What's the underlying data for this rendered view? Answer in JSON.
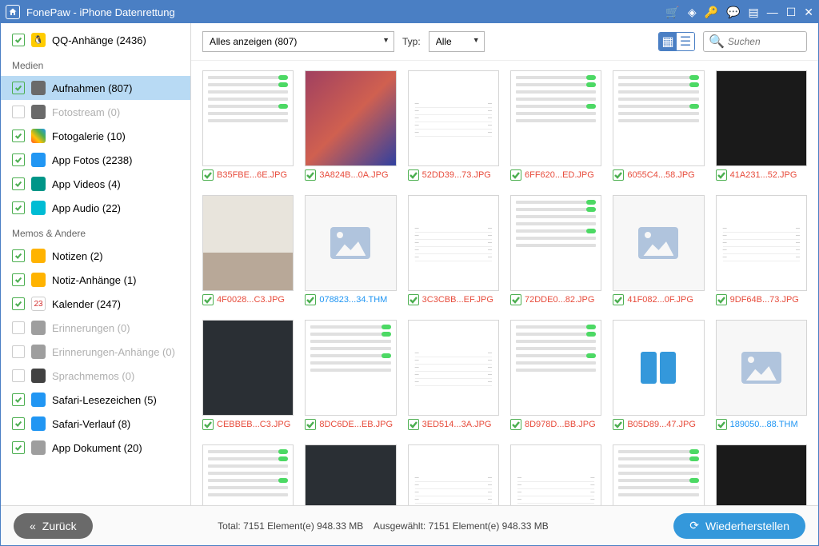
{
  "titlebar": {
    "title": "FonePaw - iPhone Datenrettung"
  },
  "sidebar": {
    "top": {
      "label": "QQ-Anhänge (2436)",
      "checked": true
    },
    "g1": "Medien",
    "items1": [
      {
        "label": "Aufnahmen (807)",
        "checked": true,
        "selected": true,
        "color": "#6a6a6a"
      },
      {
        "label": "Fotostream (0)",
        "checked": false,
        "disabled": true,
        "color": "#6a6a6a"
      },
      {
        "label": "Fotogalerie (10)",
        "checked": true,
        "color": "linear"
      },
      {
        "label": "App Fotos (2238)",
        "checked": true,
        "color": "#2196f3"
      },
      {
        "label": "App Videos (4)",
        "checked": true,
        "color": "#009688"
      },
      {
        "label": "App Audio (22)",
        "checked": true,
        "color": "#00bcd4"
      }
    ],
    "g2": "Memos & Andere",
    "items2": [
      {
        "label": "Notizen (2)",
        "checked": true,
        "color": "#ffb300"
      },
      {
        "label": "Notiz-Anhänge (1)",
        "checked": true,
        "color": "#ffb300"
      },
      {
        "label": "Kalender (247)",
        "checked": true,
        "color": "#fff",
        "txt": "23"
      },
      {
        "label": "Erinnerungen (0)",
        "checked": false,
        "disabled": true,
        "color": "#9e9e9e"
      },
      {
        "label": "Erinnerungen-Anhänge (0)",
        "checked": false,
        "disabled": true,
        "color": "#9e9e9e"
      },
      {
        "label": "Sprachmemos (0)",
        "checked": false,
        "disabled": true,
        "color": "#424242"
      },
      {
        "label": "Safari-Lesezeichen (5)",
        "checked": true,
        "color": "#2196f3"
      },
      {
        "label": "Safari-Verlauf (8)",
        "checked": true,
        "color": "#2196f3"
      },
      {
        "label": "App Dokument (20)",
        "checked": true,
        "color": "#9e9e9e"
      }
    ]
  },
  "toolbar": {
    "filter": "Alles anzeigen (807)",
    "type_label": "Typ:",
    "type": "Alle",
    "search_placeholder": "Suchen"
  },
  "grid": [
    {
      "fn": "B35FBE...6E.JPG",
      "t": "settings"
    },
    {
      "fn": "3A824B...0A.JPG",
      "t": "gradient"
    },
    {
      "fn": "52DD39...73.JPG",
      "t": "list"
    },
    {
      "fn": "6FF620...ED.JPG",
      "t": "settings"
    },
    {
      "fn": "6055C4...58.JPG",
      "t": "settings"
    },
    {
      "fn": "41A231...52.JPG",
      "t": "control"
    },
    {
      "fn": "4F0028...C3.JPG",
      "t": "photo"
    },
    {
      "fn": "078823...34.THM",
      "t": "ph",
      "blue": true
    },
    {
      "fn": "3C3CBB...EF.JPG",
      "t": "list"
    },
    {
      "fn": "72DDE0...82.JPG",
      "t": "settings"
    },
    {
      "fn": "41F082...0F.JPG",
      "t": "ph"
    },
    {
      "fn": "9DF64B...73.JPG",
      "t": "list"
    },
    {
      "fn": "CEBBEB...C3.JPG",
      "t": "dark"
    },
    {
      "fn": "8DC6DE...EB.JPG",
      "t": "settings"
    },
    {
      "fn": "3ED514...3A.JPG",
      "t": "list"
    },
    {
      "fn": "8D978D...BB.JPG",
      "t": "settings"
    },
    {
      "fn": "B05D89...47.JPG",
      "t": "phone"
    },
    {
      "fn": "189050...88.THM",
      "t": "ph",
      "blue": true
    },
    {
      "fn": "",
      "t": "settings"
    },
    {
      "fn": "",
      "t": "dark"
    },
    {
      "fn": "",
      "t": "list"
    },
    {
      "fn": "",
      "t": "list"
    },
    {
      "fn": "",
      "t": "settings"
    },
    {
      "fn": "",
      "t": "control"
    }
  ],
  "footer": {
    "back": "Zurück",
    "total_label": "Total:",
    "total_value": "7151 Element(e) 948.33 MB",
    "sel_label": "Ausgewählt:",
    "sel_value": "7151 Element(e) 948.33 MB",
    "recover": "Wiederherstellen"
  }
}
